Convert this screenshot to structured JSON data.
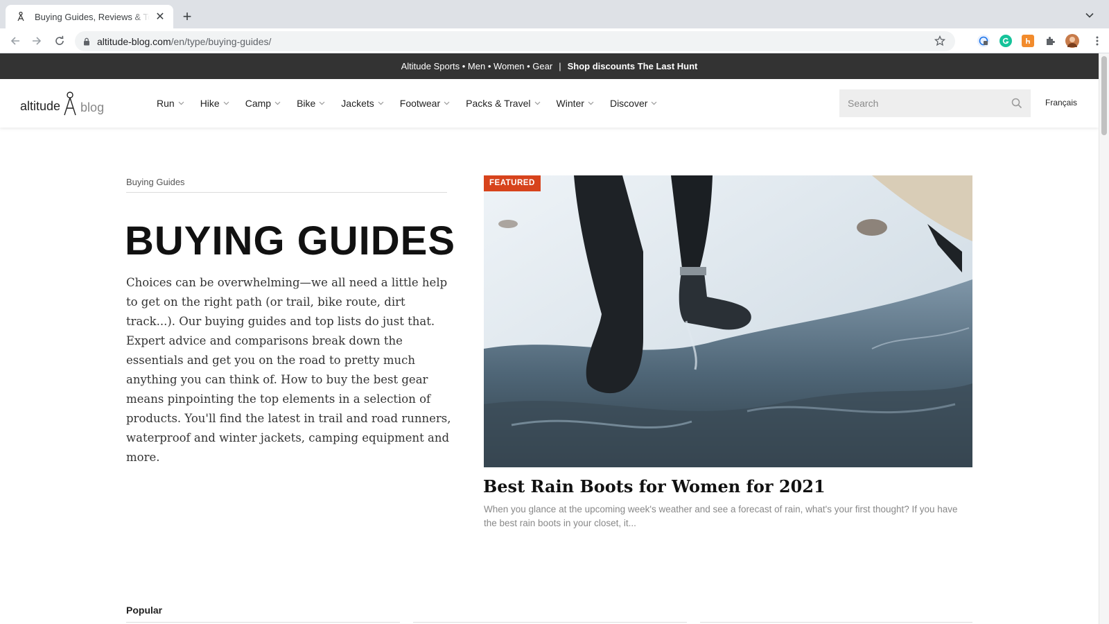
{
  "browser": {
    "tab_title": "Buying Guides, Reviews & Top Lists | Altitude Blog",
    "new_tab_symbol": "+",
    "close_symbol": "✕",
    "url_host": "altitude-blog.com",
    "url_path": "/en/type/buying-guides/"
  },
  "promo": {
    "links": "Altitude Sports • Men • Women • Gear",
    "separator": "|",
    "cta": "Shop discounts The Last Hunt"
  },
  "header": {
    "logo_word1": "altitude",
    "logo_word2": "blog",
    "nav": [
      {
        "label": "Run"
      },
      {
        "label": "Hike"
      },
      {
        "label": "Camp"
      },
      {
        "label": "Bike"
      },
      {
        "label": "Jackets"
      },
      {
        "label": "Footwear"
      },
      {
        "label": "Packs & Travel"
      },
      {
        "label": "Winter"
      },
      {
        "label": "Discover"
      }
    ],
    "search_placeholder": "Search",
    "language": "Français"
  },
  "main": {
    "breadcrumb": "Buying Guides",
    "title": "BUYING GUIDES",
    "intro": "Choices can be overwhelming—we all need a little help to get on the right path (or trail, bike route, dirt track...). Our buying guides and top lists do just that. Expert advice and comparisons break down the essentials and get you on the road to pretty much anything you can think of. How to buy the best gear means pinpointing the top elements in a selection of products. You'll find the latest in trail and road runners, waterproof and winter jackets, camping equipment and more."
  },
  "featured": {
    "badge": "FEATURED",
    "title": "Best Rain Boots for Women for 2021",
    "excerpt": "When you glance at the upcoming week's weather and see a forecast of rain, what's your first thought? If you have the best rain boots in your closet, it..."
  },
  "popular": {
    "label": "Popular"
  },
  "colors": {
    "promo_bg": "#333333",
    "badge_bg": "#d7431c",
    "search_bg": "#eeeeee"
  }
}
